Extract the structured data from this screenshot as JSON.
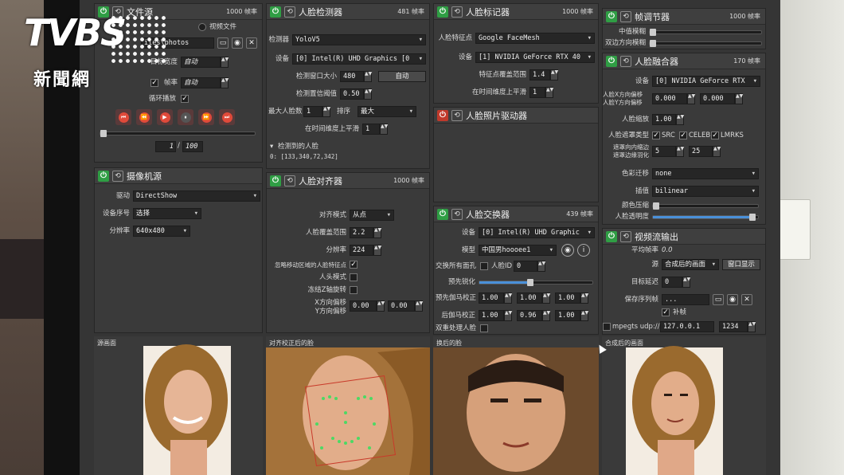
{
  "file_source": {
    "title": "文件源",
    "frame_count": "1000 帧率",
    "path_fragment": "iles\\photos",
    "video_file_label": "视频文件",
    "target_width_label": "目标宽度",
    "target_width_value": "自动",
    "fps_label": "帧率",
    "fps_value": "自动",
    "loop_label": "循环播放",
    "frame_counter_current": "1",
    "frame_counter_total": "100"
  },
  "camera_source": {
    "title": "摄像机源",
    "driver_label": "驱动",
    "driver_value": "DirectShow",
    "device_index_label": "设备序号",
    "device_index_value": "选择",
    "resolution_label": "分辨率",
    "resolution_value": "640x480"
  },
  "face_detector": {
    "title": "人脸检测器",
    "frame_count": "481 帧率",
    "detector_label": "检测器",
    "detector_value": "YoloV5",
    "device_label": "设备",
    "device_value": "[0] Intel(R) UHD Graphics [0",
    "window_size_label": "检测窗口大小",
    "window_size_value": "480",
    "auto_button": "自动",
    "threshold_label": "检测置信阈值",
    "threshold_value": "0.50",
    "max_faces_label": "最大人脸数",
    "max_faces_value": "1",
    "sort_label": "排序",
    "sort_value": "最大",
    "temporal_smoothing_label": "在时间维度上平滑",
    "temporal_smoothing_value": "1",
    "detected_faces_label": "检测到的人脸",
    "detected_faces_value": "0: [133,340,72,342]"
  },
  "face_aligner": {
    "title": "人脸对齐器",
    "frame_count": "1000 帧率",
    "align_mode_label": "对齐模式",
    "align_mode_value": "从点",
    "face_coverage_label": "人脸覆盖范围",
    "face_coverage_value": "2.2",
    "resolution_label": "分辨率",
    "resolution_value": "224",
    "exclude_moving_label": "忽略移动区域的人脸特征点",
    "head_mode_label": "人头模式",
    "freeze_z_label": "冻结Z轴旋转",
    "x_offset_label": "X方向偏移",
    "y_offset_label": "Y方向偏移",
    "x_offset_value": "0.00",
    "y_offset_value": "0.00"
  },
  "face_marker": {
    "title": "人脸标记器",
    "frame_count": "1000 帧率",
    "marker_label": "人脸特征点",
    "marker_value": "Google FaceMesh",
    "device_label": "设备",
    "device_value": "[1] NVIDIA GeForce RTX 40",
    "coverage_label": "特征点覆盖范围",
    "coverage_value": "1.4",
    "temporal_label": "在时间维度上平滑",
    "temporal_value": "1"
  },
  "face_animator": {
    "title": "人脸照片驱动器"
  },
  "face_swapper": {
    "title": "人脸交换器",
    "frame_count": "439 帧率",
    "device_label": "设备",
    "device_value": "[0] Intel(R) UHD Graphic",
    "model_label": "模型",
    "model_value": "中国男hoooee1",
    "swap_all_label": "交换所有面孔",
    "face_id_label": "人脸ID",
    "face_id_value": "0",
    "pre_sharpen_label": "预先锐化",
    "pre_gamma_label": "预先伽马校正",
    "pre_gamma_values": [
      "1.00",
      "1.00",
      "1.00"
    ],
    "post_gamma_label": "后伽马校正",
    "post_gamma_values": [
      "1.00",
      "0.96",
      "1.00"
    ],
    "dual_process_label": "双重处理人脸",
    "pre_sharpen_level": 0.45
  },
  "frame_adjuster": {
    "title": "帧调节器",
    "frame_count": "1000 帧率",
    "median_blur_label": "中值模糊",
    "bilateral_label": "双边方向模糊"
  },
  "face_merger": {
    "title": "人脸融合器",
    "frame_count": "170 帧率",
    "device_label": "设备",
    "device_value": "[0] NVIDIA GeForce RTX",
    "xy_offset_label_1": "人脸X方向偏移",
    "xy_offset_label_2": "人脸Y方向偏移",
    "x_offset_value": "0.000",
    "y_offset_value": "0.000",
    "scale_label": "人脸缩放",
    "scale_value": "1.00",
    "mask_type_label": "人脸遮罩类型",
    "mask_src": "SRC",
    "mask_celeb": "CELEB",
    "mask_lmrks": "LMRKS",
    "erode_label": "遮罩向内缩边",
    "blur_label": "遮罩边缘羽化",
    "erode_value": "5",
    "blur_value": "25",
    "color_transfer_label": "色彩迁移",
    "color_transfer_value": "none",
    "interpolation_label": "插值",
    "interpolation_value": "bilinear",
    "color_compress_label": "颜色压缩",
    "opacity_label": "人脸透明度",
    "opacity_level": 0.95
  },
  "stream_output": {
    "title": "视频流输出",
    "avg_fps_label": "平均帧率",
    "avg_fps_value": "0.0",
    "source_label": "源",
    "source_value": "合成后的画面",
    "window_button": "窗口显示",
    "delay_label": "目标延迟",
    "delay_value": "0",
    "save_path_label": "保存序列帧",
    "save_path_value": "...",
    "fill_label": "补帧",
    "mpegts_label": "mpegts udp://",
    "udp_host": "127.0.0.1",
    "udp_port": "1234"
  },
  "previews": {
    "source": "源画面",
    "aligned": "对齐校正后的脸",
    "swapped": "换后的脸",
    "merged": "合成后的画面"
  },
  "logo": {
    "brand": "TVBS",
    "subtitle": "新聞網"
  },
  "colors": {
    "accent": "#4a90d9",
    "power_on": "#2f9e44",
    "power_off": "#c0392b",
    "record_red": "#e04a3a"
  }
}
